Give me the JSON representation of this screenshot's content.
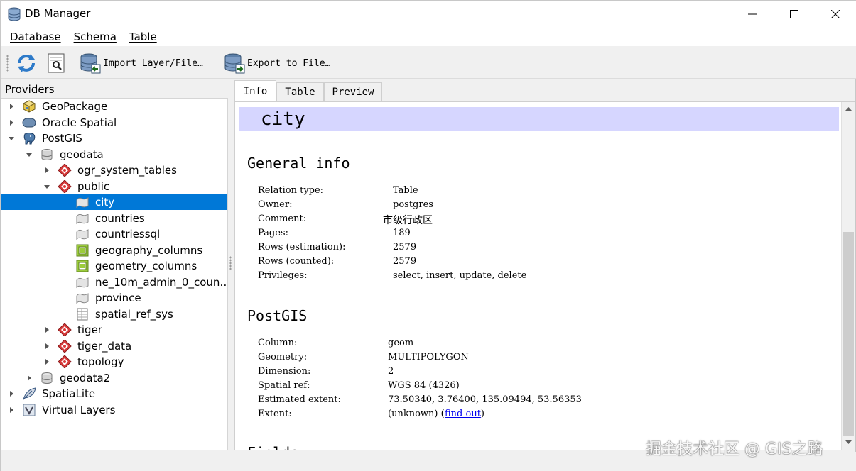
{
  "window": {
    "title": "DB Manager"
  },
  "menu": [
    {
      "label": "Database"
    },
    {
      "label": "Schema"
    },
    {
      "label": "Table"
    }
  ],
  "toolbar": {
    "import_label": "Import Layer/File…",
    "export_label": "Export to File…"
  },
  "providers": {
    "header": "Providers",
    "nodes": [
      {
        "label": "GeoPackage",
        "icon": "geopackage-icon"
      },
      {
        "label": "Oracle Spatial",
        "icon": "oracle-icon"
      },
      {
        "label": "PostGIS",
        "icon": "postgis-elephant-icon"
      },
      {
        "label": "geodata",
        "icon": "database-icon"
      },
      {
        "label": "ogr_system_tables",
        "icon": "schema-icon"
      },
      {
        "label": "public",
        "icon": "schema-icon"
      },
      {
        "label": "city",
        "icon": "polygon-layer-icon"
      },
      {
        "label": "countries",
        "icon": "polygon-layer-icon"
      },
      {
        "label": "countriessql",
        "icon": "polygon-layer-icon"
      },
      {
        "label": "geography_columns",
        "icon": "view-icon"
      },
      {
        "label": "geometry_columns",
        "icon": "view-icon"
      },
      {
        "label": "ne_10m_admin_0_coun…",
        "icon": "polygon-layer-icon"
      },
      {
        "label": "province",
        "icon": "polygon-layer-icon"
      },
      {
        "label": "spatial_ref_sys",
        "icon": "table-icon"
      },
      {
        "label": "tiger",
        "icon": "schema-icon"
      },
      {
        "label": "tiger_data",
        "icon": "schema-icon"
      },
      {
        "label": "topology",
        "icon": "schema-icon"
      },
      {
        "label": "geodata2",
        "icon": "database-icon"
      },
      {
        "label": "SpatiaLite",
        "icon": "spatialite-feather-icon"
      },
      {
        "label": "Virtual Layers",
        "icon": "virtual-layers-icon"
      }
    ]
  },
  "tabs": [
    {
      "label": "Info"
    },
    {
      "label": "Table"
    },
    {
      "label": "Preview"
    }
  ],
  "info": {
    "title": "city",
    "general_header": "General info",
    "general": [
      {
        "key": "Relation type:",
        "value": "Table"
      },
      {
        "key": "Owner:",
        "value": "postgres"
      },
      {
        "key": "Comment:",
        "value": "市级行政区"
      },
      {
        "key": "Pages:",
        "value": "189"
      },
      {
        "key": "Rows (estimation):",
        "value": "2579"
      },
      {
        "key": "Rows (counted):",
        "value": "2579"
      },
      {
        "key": "Privileges:",
        "value": "select, insert, update, delete"
      }
    ],
    "postgis_header": "PostGIS",
    "postgis": [
      {
        "key": "Column:",
        "value": "geom"
      },
      {
        "key": "Geometry:",
        "value": "MULTIPOLYGON"
      },
      {
        "key": "Dimension:",
        "value": "2"
      },
      {
        "key": "Spatial ref:",
        "value": "WGS 84 (4326)"
      },
      {
        "key": "Estimated extent:",
        "value": "73.50340, 3.76400, 135.09494, 53.56353"
      },
      {
        "key": "Extent:",
        "value": "(unknown) ("
      }
    ],
    "find_out": "find out",
    "close_paren": ")",
    "fields_header_partial": "Fields"
  },
  "watermark": "掘金技术社区 @ GIS之路",
  "colors": {
    "selection": "#0078d7",
    "title_band": "#d6d6ff",
    "link": "#0000ee"
  }
}
